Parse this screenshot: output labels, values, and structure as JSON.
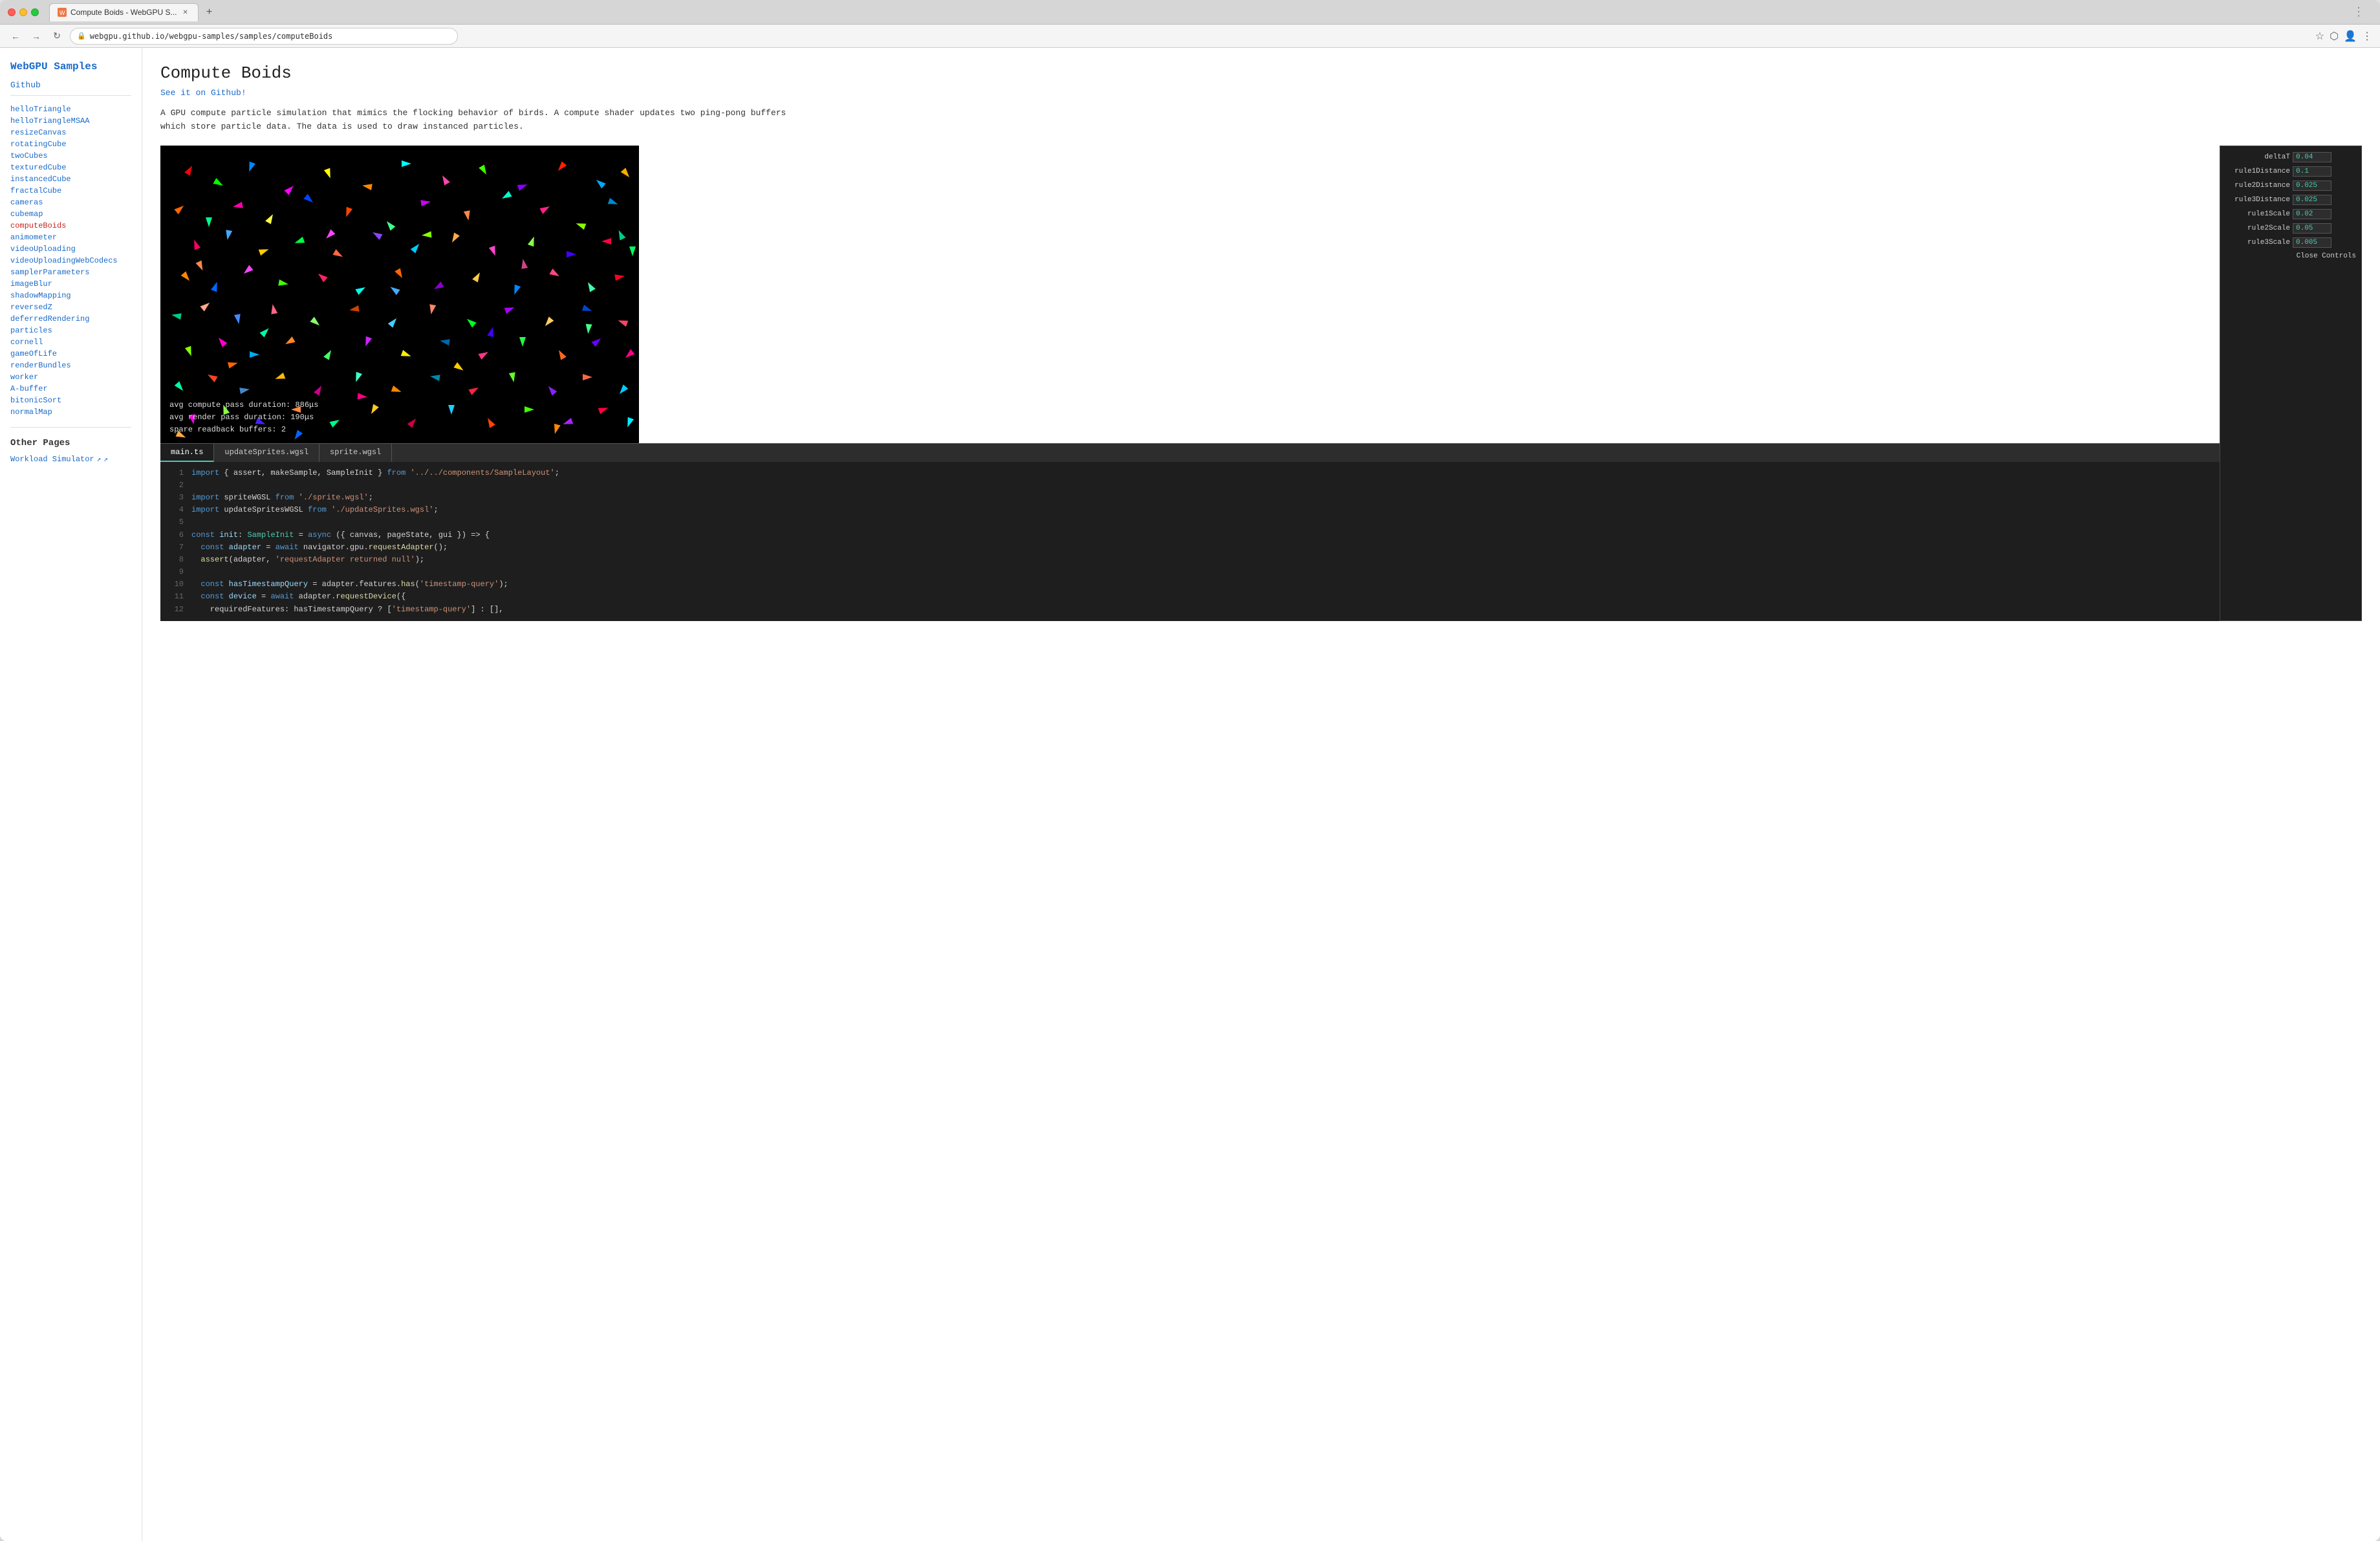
{
  "browser": {
    "tab_title": "Compute Boids - WebGPU S...",
    "url": "webgpu.github.io/webgpu-samples/samples/computeBoids",
    "new_tab_label": "+"
  },
  "sidebar": {
    "title": "WebGPU Samples",
    "github_label": "Github",
    "links": [
      "helloTriangle",
      "helloTriangleMSAA",
      "resizeCanvas",
      "rotatingCube",
      "twoCubes",
      "texturedCube",
      "instancedCube",
      "fractalCube",
      "cameras",
      "cubemap",
      "computeBoids",
      "animometer",
      "videoUploading",
      "videoUploadingWebCodecs",
      "samplerParameters",
      "imageBlur",
      "shadowMapping",
      "reversedZ",
      "deferredRendering",
      "particles",
      "cornell",
      "gameOfLife",
      "renderBundles",
      "worker",
      "A-buffer",
      "bitonicSort",
      "normalMap"
    ],
    "active_link": "computeBoids",
    "other_pages_title": "Other Pages",
    "workload_simulator_label": "Workload Simulator ↗"
  },
  "page": {
    "title": "Compute Boids",
    "github_link": "See it on Github!",
    "description": "A GPU compute particle simulation that mimics the flocking behavior of birds. A compute shader updates two ping-pong buffers which store particle data. The data is used to draw instanced particles."
  },
  "controls": {
    "items": [
      {
        "label": "deltaT",
        "value": "0.04"
      },
      {
        "label": "rule1Distance",
        "value": "0.1"
      },
      {
        "label": "rule2Distance",
        "value": "0.025"
      },
      {
        "label": "rule3Distance",
        "value": "0.025"
      },
      {
        "label": "rule1Scale",
        "value": "0.02"
      },
      {
        "label": "rule2Scale",
        "value": "0.05"
      },
      {
        "label": "rule3Scale",
        "value": "0.005"
      }
    ],
    "close_label": "Close Controls"
  },
  "stats": {
    "compute_pass": "avg compute pass duration:  886μs",
    "render_pass": "avg render pass duration:   190μs",
    "spare_buffers": "spare readback buffers:     2"
  },
  "code_tabs": {
    "tabs": [
      "main.ts",
      "updateSprites.wgsl",
      "sprite.wgsl"
    ],
    "active_tab": "main.ts"
  },
  "code_lines": [
    {
      "num": "1",
      "text": "import { assert, makeSample, SampleInit } from '../../components/SampleLayout';"
    },
    {
      "num": "2",
      "text": ""
    },
    {
      "num": "3",
      "text": "import spriteWGSL from './sprite.wgsl';"
    },
    {
      "num": "4",
      "text": "import updateSpritesWGSL from './updateSprites.wgsl';"
    },
    {
      "num": "5",
      "text": ""
    },
    {
      "num": "6",
      "text": "const init: SampleInit = async ({ canvas, pageState, gui }) => {"
    },
    {
      "num": "7",
      "text": "  const adapter = await navigator.gpu.requestAdapter();"
    },
    {
      "num": "8",
      "text": "  assert(adapter, 'requestAdapter returned null');"
    },
    {
      "num": "9",
      "text": ""
    },
    {
      "num": "10",
      "text": "  const hasTimestampQuery = adapter.features.has('timestamp-query');"
    },
    {
      "num": "11",
      "text": "  const device = await adapter.requestDevice({"
    },
    {
      "num": "12",
      "text": "    requiredFeatures: hasTimestampQuery ? ['timestamp-query'] : [],"
    }
  ]
}
